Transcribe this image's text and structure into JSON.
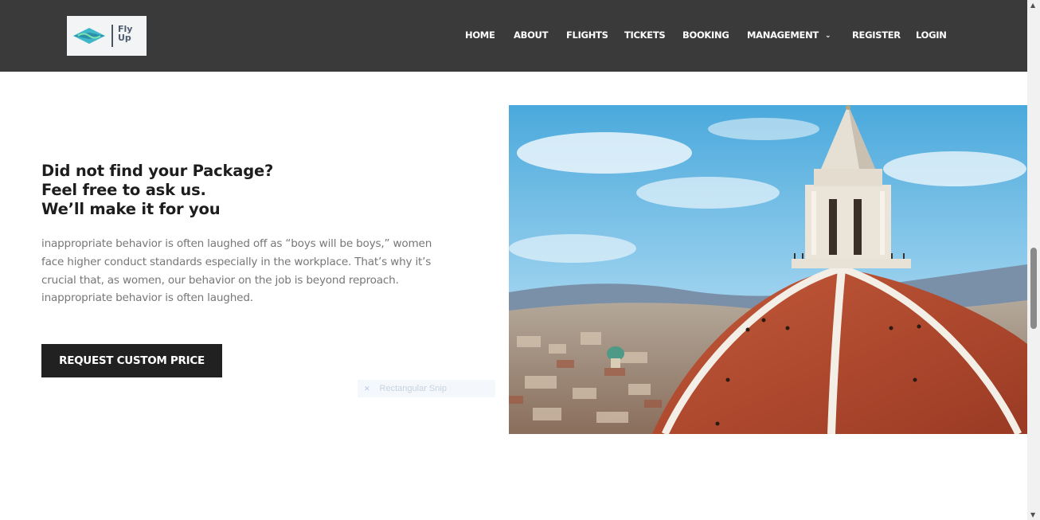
{
  "logo": {
    "line1": "Fly",
    "line2": "Up"
  },
  "nav": {
    "items": [
      {
        "label": "HOME"
      },
      {
        "label": "ABOUT"
      },
      {
        "label": "FLIGHTS"
      },
      {
        "label": "TICKETS"
      },
      {
        "label": "BOOKING"
      },
      {
        "label": "MANAGEMENT",
        "has_dropdown": true
      },
      {
        "label": "REGISTER"
      },
      {
        "label": "LOGIN"
      }
    ]
  },
  "promo": {
    "heading_lines": [
      "Did not find your Package?",
      "Feel free to ask us.",
      "We’ll make it for you"
    ],
    "body": "inappropriate behavior is often laughed off as “boys will be boys,” women face higher conduct standards especially in the workplace. That’s why it’s crucial that, as women, our behavior on the job is beyond reproach. inappropriate behavior is often laughed.",
    "cta_label": "REQUEST CUSTOM PRICE"
  },
  "overlay": {
    "snip_label": "Rectangular Snip"
  },
  "colors": {
    "header_bg": "#3a3a3a",
    "cta_bg": "#212121",
    "heading": "#1d1d1d",
    "body_text": "#777777"
  }
}
